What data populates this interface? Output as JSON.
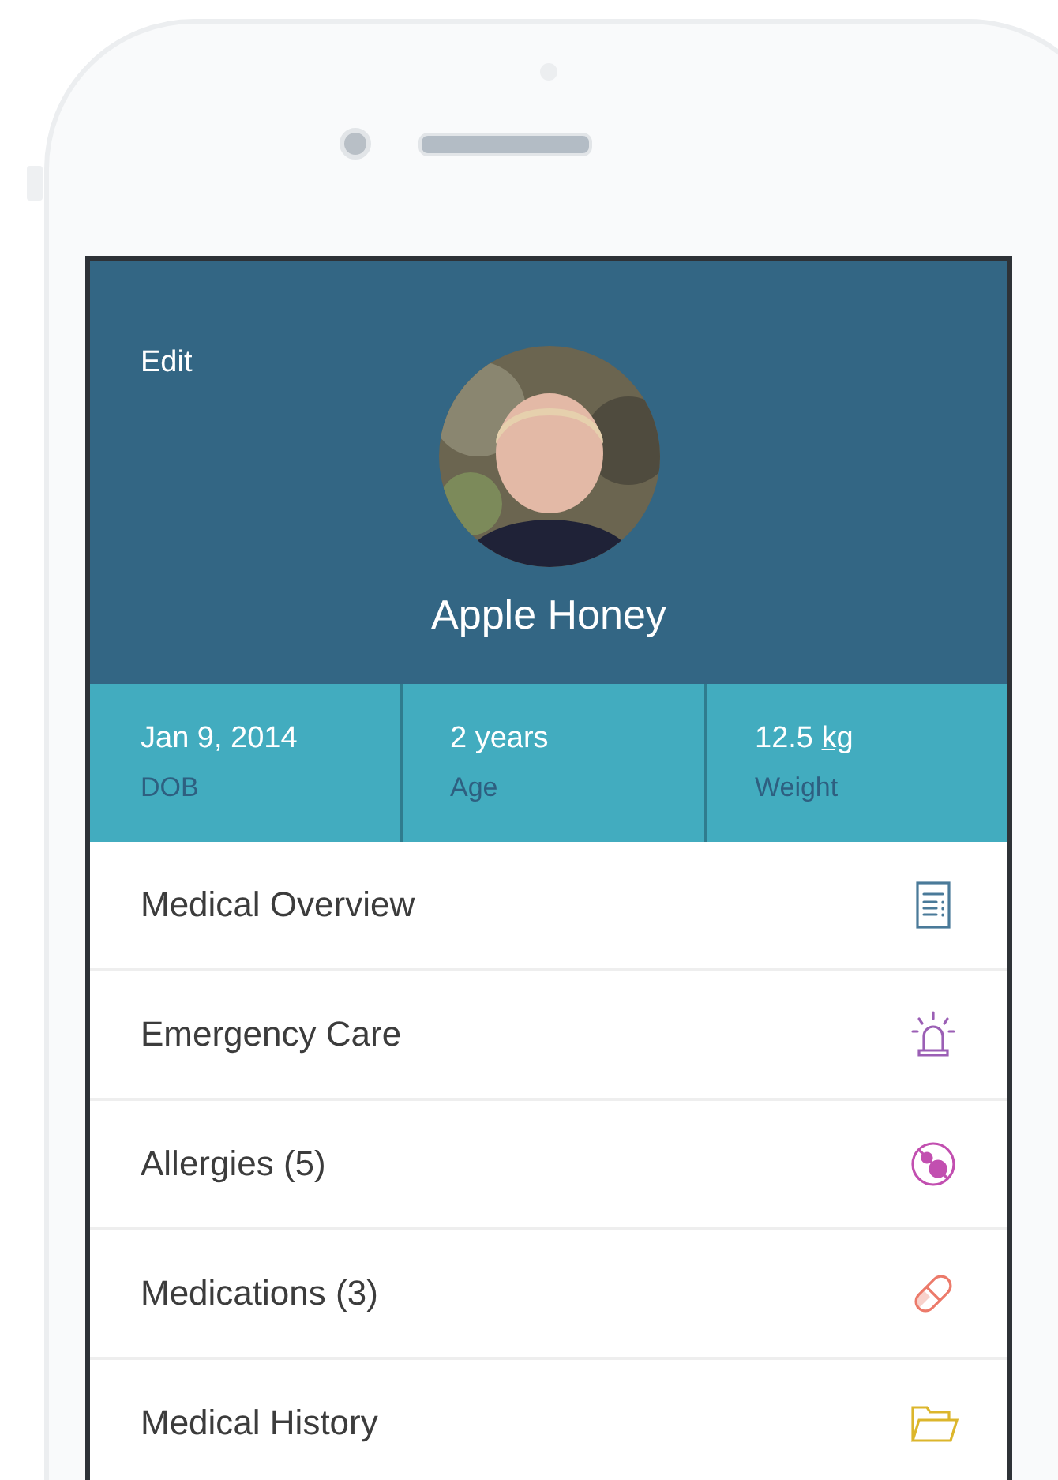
{
  "header": {
    "edit": "Edit",
    "name": "Apple Honey"
  },
  "stats": [
    {
      "value": "Jan 9, 2014",
      "label": "DOB"
    },
    {
      "value": "2 years",
      "label": "Age"
    },
    {
      "value": "12.5",
      "unit": "kg",
      "label": "Weight"
    }
  ],
  "menu": [
    {
      "label": "Medical Overview",
      "kind": "document",
      "color": "#4a7a99"
    },
    {
      "label": "Emergency Care",
      "kind": "siren",
      "color": "#9b5fb5"
    },
    {
      "label": "Allergies (5)",
      "kind": "allergy",
      "color": "#c24fb0"
    },
    {
      "label": "Medications (3)",
      "kind": "pill",
      "color": "#ec7a6a"
    },
    {
      "label": "Medical History",
      "kind": "folder",
      "color": "#dcb62c"
    }
  ]
}
